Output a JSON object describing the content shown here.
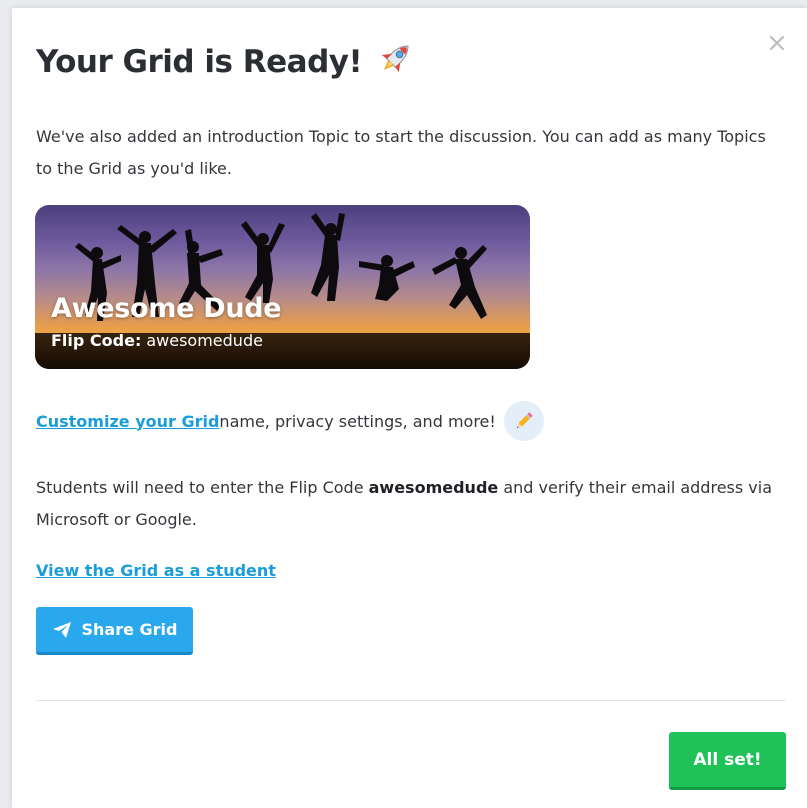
{
  "modal": {
    "title": "Your Grid is Ready!",
    "title_icon": "rocket-icon",
    "close_icon": "close-icon",
    "intro": "We've also added an introduction Topic to start the discussion. You can add as many Topics to the Grid as you'd like."
  },
  "banner": {
    "grid_name": "Awesome Dude",
    "flip_code_label": "Flip Code:",
    "flip_code": "awesomedude"
  },
  "customize": {
    "link_text": "Customize your Grid ",
    "rest_text": "name, privacy settings, and more!",
    "icon": "pencil-icon"
  },
  "students": {
    "before": "Students will need to enter the Flip Code ",
    "code": "awesomedude",
    "after": " and verify their email address via Microsoft or Google."
  },
  "view_link": "View the Grid as a student",
  "share_button": {
    "label": "Share Grid",
    "icon": "paper-plane-icon"
  },
  "done_button": {
    "label": "All set!"
  },
  "colors": {
    "link": "#1a9ddb",
    "share_button": "#2aa8ee",
    "done_button": "#1fc257",
    "title_text": "#2b2f33"
  }
}
